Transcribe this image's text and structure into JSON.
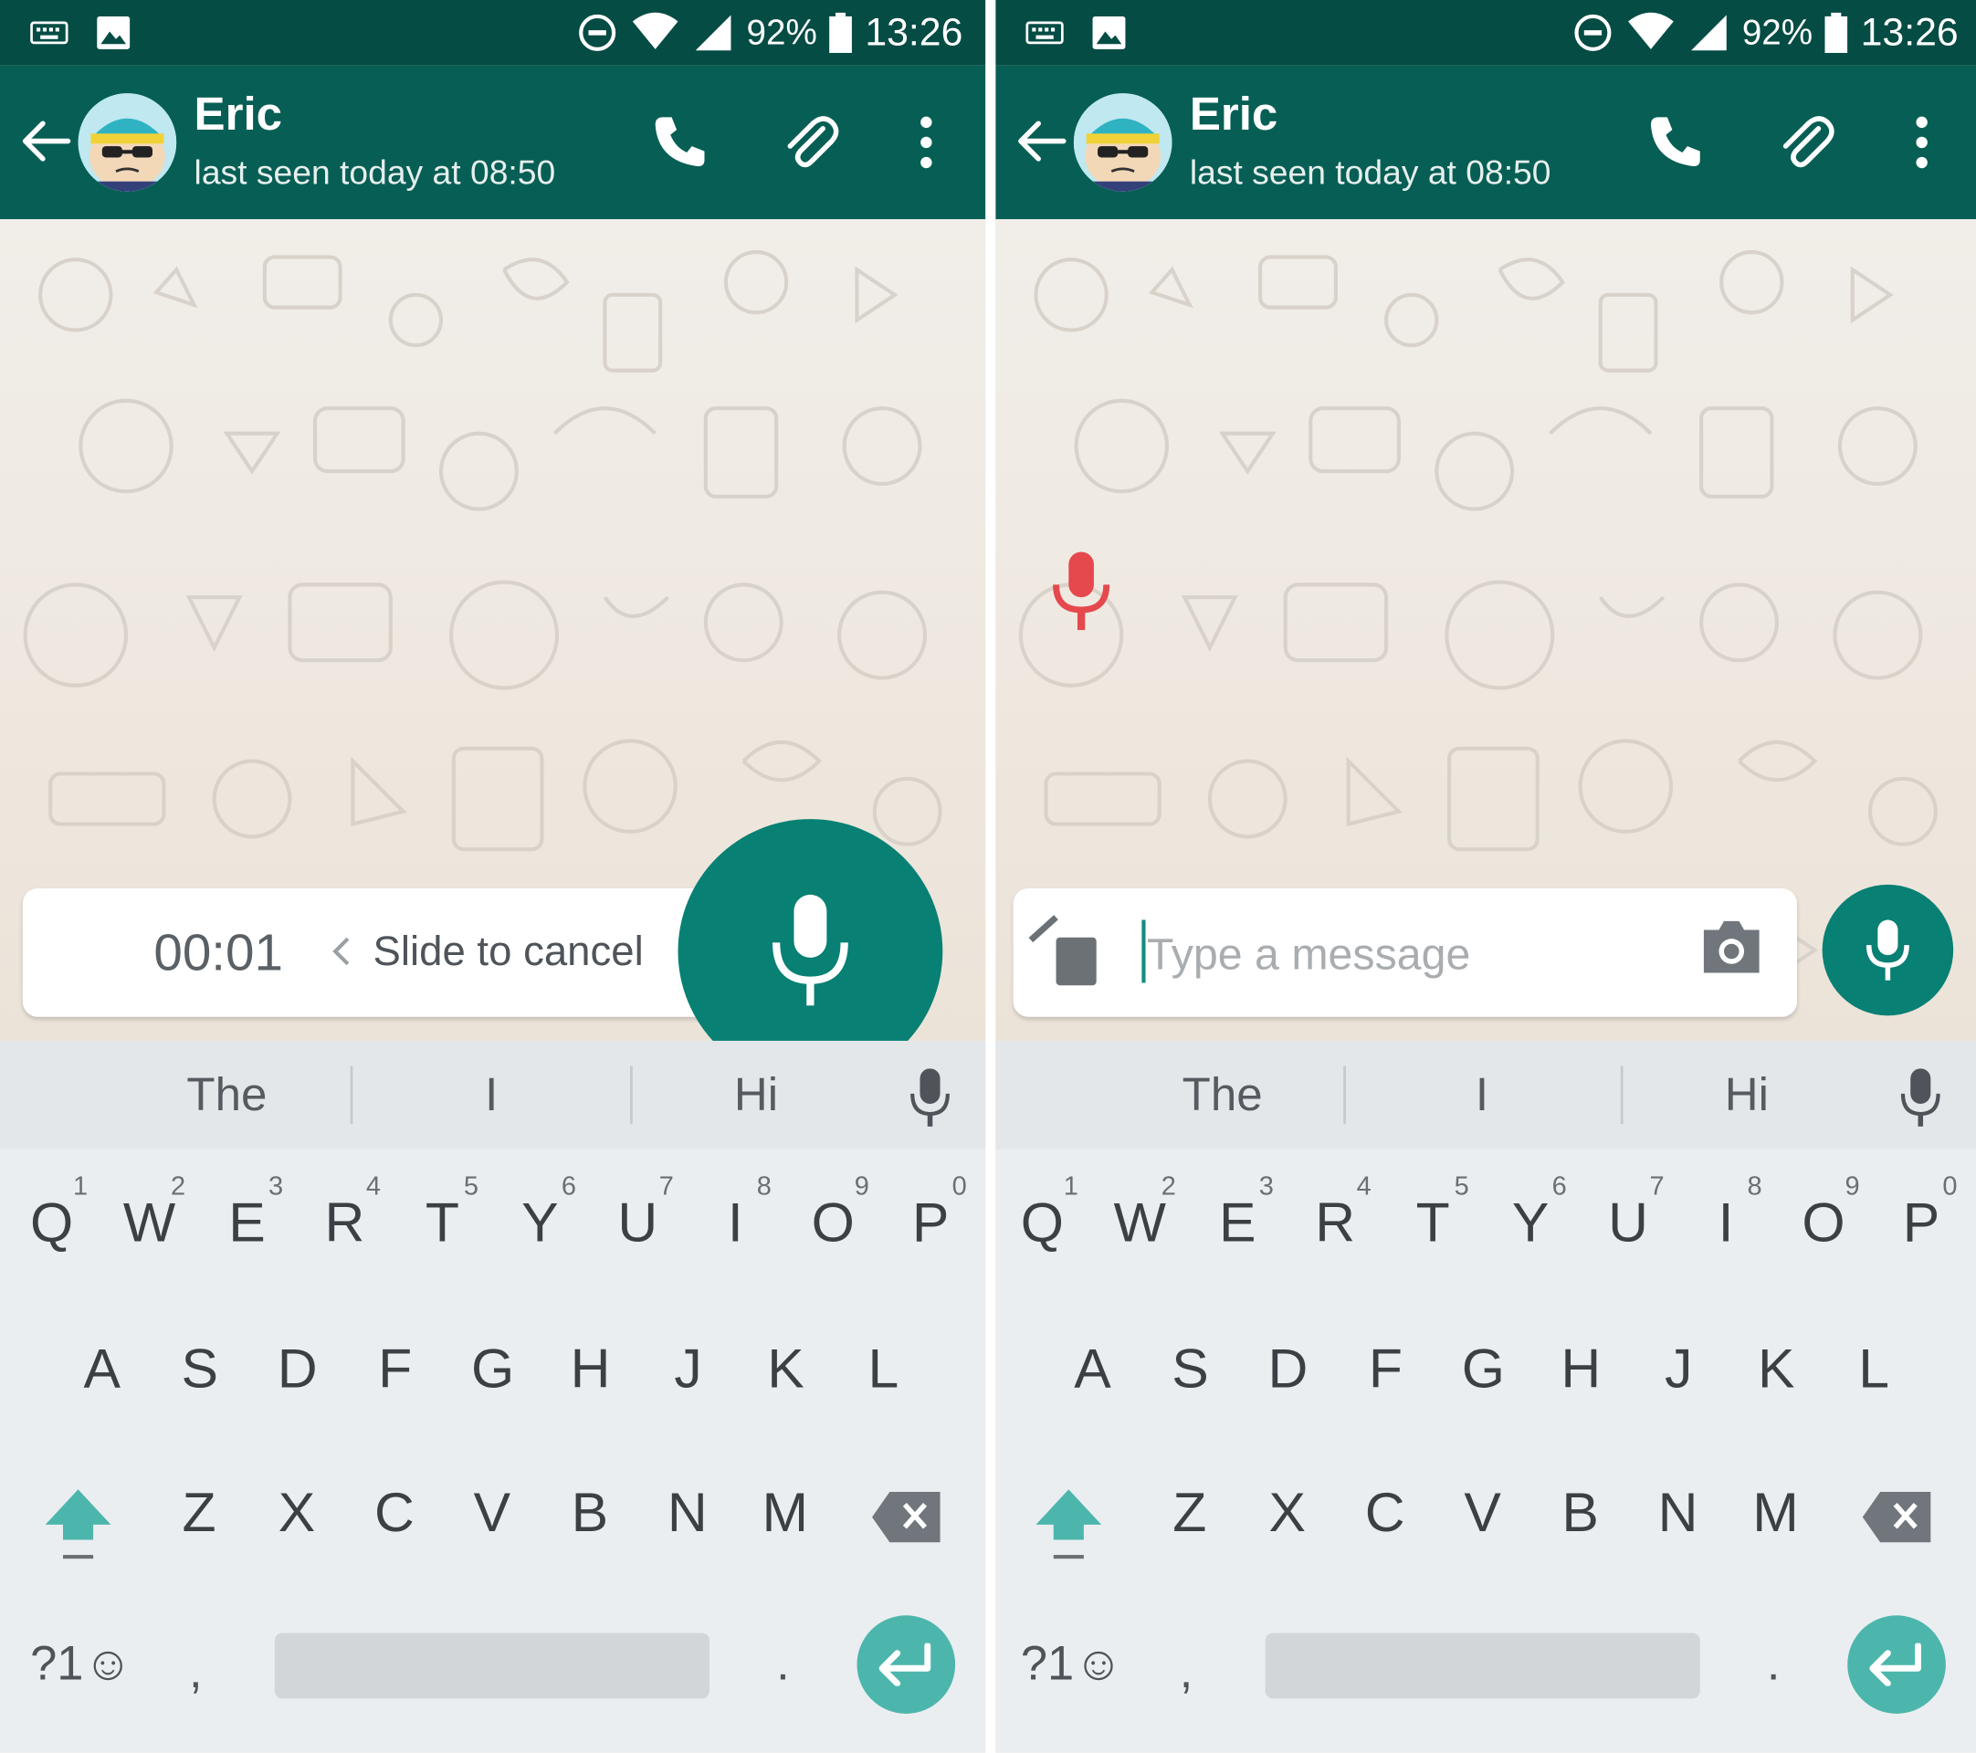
{
  "screens": [
    {
      "status": {
        "battery": "92%",
        "time": "13:26"
      },
      "header": {
        "contact_name": "Eric",
        "last_seen": "last seen today at 08:50"
      },
      "recording": {
        "timer": "00:01",
        "slide_hint": "Slide to cancel"
      },
      "suggestions": [
        "The",
        "I",
        "Hi"
      ],
      "keyboard": {
        "row1": [
          "Q",
          "W",
          "E",
          "R",
          "T",
          "Y",
          "U",
          "I",
          "O",
          "P"
        ],
        "row1_hints": [
          "1",
          "2",
          "3",
          "4",
          "5",
          "6",
          "7",
          "8",
          "9",
          "0"
        ],
        "row2": [
          "A",
          "S",
          "D",
          "F",
          "G",
          "H",
          "J",
          "K",
          "L"
        ],
        "row3": [
          "Z",
          "X",
          "C",
          "V",
          "B",
          "N",
          "M"
        ],
        "symbols_key": "?1☺",
        "comma": ",",
        "period": "."
      }
    },
    {
      "status": {
        "battery": "92%",
        "time": "13:26"
      },
      "header": {
        "contact_name": "Eric",
        "last_seen": "last seen today at 08:50"
      },
      "composer": {
        "placeholder": "Type a message"
      },
      "suggestions": [
        "The",
        "I",
        "Hi"
      ],
      "keyboard": {
        "row1": [
          "Q",
          "W",
          "E",
          "R",
          "T",
          "Y",
          "U",
          "I",
          "O",
          "P"
        ],
        "row1_hints": [
          "1",
          "2",
          "3",
          "4",
          "5",
          "6",
          "7",
          "8",
          "9",
          "0"
        ],
        "row2": [
          "A",
          "S",
          "D",
          "F",
          "G",
          "H",
          "J",
          "K",
          "L"
        ],
        "row3": [
          "Z",
          "X",
          "C",
          "V",
          "B",
          "N",
          "M"
        ],
        "symbols_key": "?1☺",
        "comma": ",",
        "period": "."
      }
    }
  ],
  "colors": {
    "status_bar": "#054c44",
    "app_bar": "#075e54",
    "accent": "#088073",
    "enter_key": "#4db6ac",
    "mic_red": "#e5484d"
  }
}
